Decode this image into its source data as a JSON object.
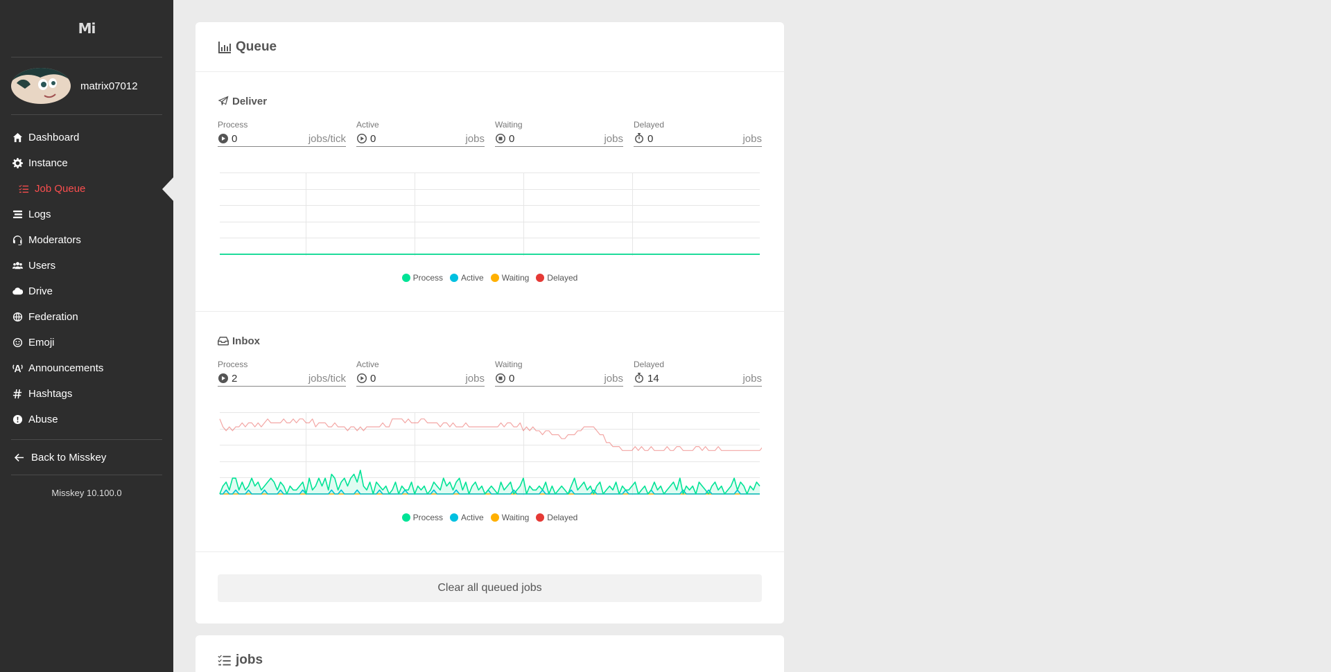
{
  "app": {
    "logo": "Mi",
    "version": "Misskey 10.100.0"
  },
  "user": {
    "name": "matrix07012"
  },
  "nav": [
    {
      "label": "Dashboard",
      "icon": "home-icon"
    },
    {
      "label": "Instance",
      "icon": "cog-icon"
    },
    {
      "label": "Job Queue",
      "icon": "tasks-icon",
      "active": true
    },
    {
      "label": "Logs",
      "icon": "stream-icon"
    },
    {
      "label": "Moderators",
      "icon": "headset-icon"
    },
    {
      "label": "Users",
      "icon": "users-icon"
    },
    {
      "label": "Drive",
      "icon": "cloud-icon"
    },
    {
      "label": "Federation",
      "icon": "globe-icon"
    },
    {
      "label": "Emoji",
      "icon": "smile-icon"
    },
    {
      "label": "Announcements",
      "icon": "broadcast-icon"
    },
    {
      "label": "Hashtags",
      "icon": "hashtag-icon"
    },
    {
      "label": "Abuse",
      "icon": "exclamation-icon"
    }
  ],
  "back_label": "Back to Misskey",
  "queue": {
    "title": "Queue",
    "deliver": {
      "title": "Deliver",
      "stats": [
        {
          "label": "Process",
          "value": "0",
          "unit": "jobs/tick"
        },
        {
          "label": "Active",
          "value": "0",
          "unit": "jobs"
        },
        {
          "label": "Waiting",
          "value": "0",
          "unit": "jobs"
        },
        {
          "label": "Delayed",
          "value": "0",
          "unit": "jobs"
        }
      ]
    },
    "inbox": {
      "title": "Inbox",
      "stats": [
        {
          "label": "Process",
          "value": "2",
          "unit": "jobs/tick"
        },
        {
          "label": "Active",
          "value": "0",
          "unit": "jobs"
        },
        {
          "label": "Waiting",
          "value": "0",
          "unit": "jobs"
        },
        {
          "label": "Delayed",
          "value": "14",
          "unit": "jobs"
        }
      ]
    },
    "legend": [
      {
        "name": "Process",
        "color": "#00e396"
      },
      {
        "name": "Active",
        "color": "#00c0e0"
      },
      {
        "name": "Waiting",
        "color": "#ffb000"
      },
      {
        "name": "Delayed",
        "color": "#e53935"
      }
    ],
    "clear_label": "Clear all queued jobs"
  },
  "jobs": {
    "title": "jobs"
  },
  "chart_data": [
    {
      "type": "line",
      "series": [
        {
          "name": "Process",
          "color": "#00e396",
          "values": [
            0,
            0,
            0,
            0,
            0,
            0,
            0,
            0,
            0,
            0,
            0,
            0,
            0,
            0,
            0,
            0,
            0,
            0,
            0,
            0,
            0,
            0,
            0,
            0,
            0,
            0,
            0,
            0,
            0,
            0
          ]
        },
        {
          "name": "Active",
          "color": "#00c0e0",
          "values": [
            0,
            0,
            0,
            0,
            0,
            0,
            0,
            0,
            0,
            0,
            0,
            0,
            0,
            0,
            0,
            0,
            0,
            0,
            0,
            0,
            0,
            0,
            0,
            0,
            0,
            0,
            0,
            0,
            0,
            0
          ]
        },
        {
          "name": "Waiting",
          "color": "#ffb000",
          "values": [
            0,
            0,
            0,
            0,
            0,
            0,
            0,
            0,
            0,
            0,
            0,
            0,
            0,
            0,
            0,
            0,
            0,
            0,
            0,
            0,
            0,
            0,
            0,
            0,
            0,
            0,
            0,
            0,
            0,
            0
          ]
        },
        {
          "name": "Delayed",
          "color": "#e53935",
          "values": [
            0,
            0,
            0,
            0,
            0,
            0,
            0,
            0,
            0,
            0,
            0,
            0,
            0,
            0,
            0,
            0,
            0,
            0,
            0,
            0,
            0,
            0,
            0,
            0,
            0,
            0,
            0,
            0,
            0,
            0
          ]
        }
      ],
      "ylim": [
        0,
        5
      ]
    },
    {
      "type": "line",
      "series": [
        {
          "name": "Process",
          "color": "#00e396",
          "values": [
            0,
            2,
            3,
            1,
            4,
            4,
            1,
            3,
            1,
            2,
            4,
            2,
            3,
            1,
            2,
            3,
            4,
            3,
            1,
            3,
            2,
            0,
            2,
            1,
            1,
            2,
            3,
            0,
            4,
            1,
            2,
            4,
            2,
            4,
            1,
            5,
            4,
            1,
            3,
            4,
            2,
            4,
            5,
            3,
            6,
            2,
            1,
            3,
            0,
            3,
            2,
            1,
            2,
            0,
            1,
            3,
            0,
            2,
            1,
            1,
            3,
            0,
            2,
            1,
            2,
            0,
            1,
            3,
            2,
            1,
            4,
            2,
            3,
            1,
            3,
            4,
            1,
            3,
            0,
            2,
            3,
            1,
            2,
            0,
            1,
            2,
            1,
            0,
            3,
            1,
            2,
            3,
            0,
            1,
            2,
            4,
            0,
            2,
            1,
            1,
            2,
            1,
            3,
            0,
            2,
            0,
            1,
            2,
            1,
            0,
            2,
            4,
            1,
            2,
            3,
            1,
            2,
            0,
            2,
            3,
            0,
            1,
            2,
            1,
            3,
            0,
            2,
            1,
            1,
            2,
            3,
            0,
            1,
            2,
            0,
            1,
            3,
            1,
            2,
            0,
            1,
            2,
            3,
            1,
            4,
            0,
            2,
            1,
            2,
            0,
            3,
            2,
            1,
            0,
            2,
            3,
            1,
            2,
            0,
            1,
            2,
            4,
            1,
            3,
            2,
            0,
            2,
            1,
            3,
            2
          ]
        },
        {
          "name": "Active",
          "color": "#00c0e0",
          "values": [
            0,
            0,
            1,
            0,
            0,
            1,
            0,
            0,
            0,
            1,
            0,
            0,
            0,
            0,
            1,
            0,
            0,
            0,
            0,
            1,
            0,
            0,
            0,
            0,
            0,
            0,
            1,
            0,
            0,
            0,
            0,
            0,
            0,
            0,
            0,
            1,
            0,
            0,
            1,
            0,
            0,
            0,
            0,
            1,
            0,
            0,
            0,
            0,
            0,
            0,
            1,
            0,
            0,
            0,
            0,
            0,
            0,
            0,
            1,
            0,
            0,
            0,
            0,
            0,
            0,
            0,
            0,
            1,
            0,
            0,
            0,
            0,
            0,
            0,
            1,
            0,
            0,
            0,
            0,
            0,
            0,
            0,
            0,
            0,
            1,
            0,
            0,
            0,
            0,
            0,
            0,
            0,
            1,
            0,
            0,
            0,
            0,
            0,
            0,
            0,
            0,
            1,
            0,
            0,
            0,
            0,
            0,
            0,
            0,
            0,
            1,
            0,
            0,
            0,
            0,
            0,
            0,
            1,
            0,
            0,
            0,
            0,
            0,
            0,
            0,
            0,
            0,
            1,
            0,
            0,
            0,
            0,
            0,
            0,
            0,
            1,
            0,
            0,
            0,
            0,
            0,
            0,
            0,
            0,
            0,
            1,
            0,
            0,
            0,
            0,
            0,
            0,
            0,
            1,
            0,
            0,
            0,
            0,
            0,
            0,
            0,
            0,
            1,
            0,
            0,
            0,
            0,
            0,
            0,
            0
          ]
        },
        {
          "name": "Waiting",
          "color": "#ffb000",
          "values": [
            0,
            0,
            0,
            0,
            0,
            0,
            0,
            0,
            0,
            0,
            0,
            0,
            0,
            0,
            0,
            0,
            0,
            0,
            0,
            0,
            0,
            0,
            0,
            0,
            0,
            0,
            0,
            0,
            0,
            0,
            0,
            0,
            0,
            0,
            0,
            0,
            0,
            0,
            0,
            0,
            0,
            0,
            0,
            0,
            0,
            0,
            0,
            0,
            0,
            0,
            0,
            0,
            0,
            0,
            0,
            0,
            0,
            0,
            0,
            0,
            0,
            0,
            0,
            0,
            0,
            0,
            0,
            0,
            0,
            0,
            0,
            0,
            0,
            0,
            0,
            0,
            0,
            0,
            0,
            0,
            0,
            0,
            0,
            0,
            0,
            0,
            0,
            0,
            0,
            0,
            0,
            0,
            0,
            0,
            0,
            0,
            0,
            0,
            0,
            0,
            0,
            0,
            0,
            0,
            0,
            0,
            0,
            0,
            0,
            0,
            0,
            0,
            0,
            0,
            0,
            0,
            0,
            0,
            0,
            0,
            0,
            0,
            0,
            0,
            0,
            0,
            0,
            0,
            0,
            0,
            0,
            0,
            0,
            0,
            0,
            0,
            0,
            0,
            0,
            0,
            0,
            0,
            0,
            0,
            0,
            0,
            0,
            0,
            0,
            0,
            0,
            0,
            0,
            0,
            0,
            0,
            0,
            0,
            0,
            0,
            0,
            0,
            0,
            0,
            0,
            0,
            0,
            0,
            0,
            0
          ]
        },
        {
          "name": "Delayed",
          "color": "#e53935",
          "values": [
            19,
            17,
            16,
            17,
            16,
            17,
            17,
            18,
            17,
            18,
            18,
            17,
            18,
            17,
            18,
            19,
            18,
            18,
            18,
            18,
            19,
            18,
            18,
            19,
            18,
            19,
            19,
            18,
            18,
            19,
            17,
            18,
            18,
            18,
            17,
            17,
            18,
            17,
            17,
            17,
            16,
            17,
            17,
            16,
            17,
            16,
            17,
            17,
            17,
            17,
            17,
            18,
            17,
            17,
            19,
            19,
            19,
            19,
            18,
            19,
            18,
            18,
            18,
            19,
            19,
            18,
            18,
            18,
            18,
            17,
            18,
            18,
            17,
            18,
            17,
            17,
            17,
            18,
            17,
            17,
            17,
            17,
            17,
            17,
            17,
            17,
            17,
            17,
            18,
            17,
            18,
            18,
            17,
            17,
            18,
            16,
            17,
            16,
            17,
            16,
            16,
            15,
            16,
            16,
            15,
            15,
            15,
            14,
            14,
            15,
            15,
            15,
            16,
            16,
            17,
            17,
            17,
            17,
            16,
            15,
            15,
            13,
            13,
            12,
            12,
            12,
            11,
            11,
            11,
            11,
            12,
            11,
            12,
            11,
            11,
            12,
            11,
            11,
            11,
            11,
            12,
            11,
            11,
            12,
            12,
            11,
            11,
            11,
            11,
            12,
            12,
            11,
            12,
            11,
            11,
            11,
            12,
            11,
            11,
            11,
            11,
            11,
            11,
            11,
            11,
            11,
            11,
            11,
            11,
            11,
            12,
            11,
            12,
            12,
            11,
            11,
            11,
            12,
            12,
            12,
            13,
            12,
            12,
            11,
            12
          ]
        }
      ],
      "ylim": [
        0,
        20
      ]
    }
  ]
}
